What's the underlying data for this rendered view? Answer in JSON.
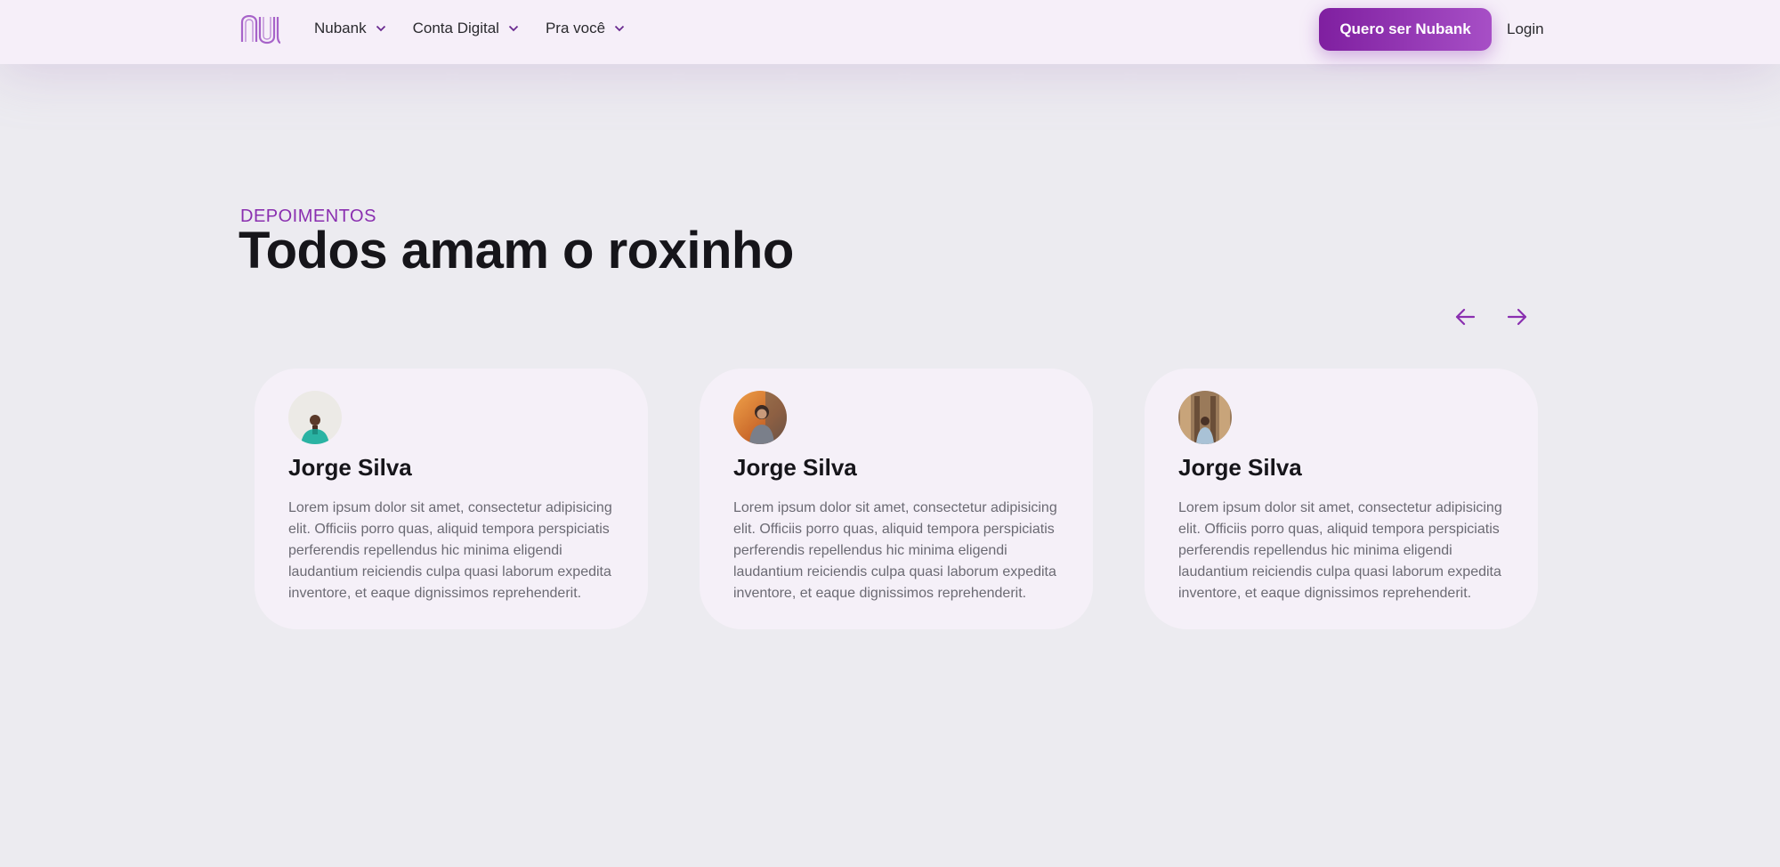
{
  "header": {
    "logo_icon": "nubank-logo-icon",
    "nav": [
      {
        "label": "Nubank"
      },
      {
        "label": "Conta Digital"
      },
      {
        "label": "Pra você"
      }
    ],
    "cta_label": "Quero ser Nubank",
    "login_label": "Login"
  },
  "section": {
    "eyebrow": "DEPOIMENTOS",
    "title": "Todos amam o roxinho",
    "prev_icon": "arrow-left-icon",
    "next_icon": "arrow-right-icon"
  },
  "testimonials": [
    {
      "name": "Jorge Silva",
      "text": "Lorem ipsum dolor sit amet, consectetur adipisicing elit. Officiis porro quas, aliquid tempora perspiciatis perferendis repellendus hic minima eligendi laudantium reiciendis culpa quasi laborum expedita inventore, et eaque dignissimos reprehenderit."
    },
    {
      "name": "Jorge Silva",
      "text": "Lorem ipsum dolor sit amet, consectetur adipisicing elit. Officiis porro quas, aliquid tempora perspiciatis perferendis repellendus hic minima eligendi laudantium reiciendis culpa quasi laborum expedita inventore, et eaque dignissimos reprehenderit."
    },
    {
      "name": "Jorge Silva",
      "text": "Lorem ipsum dolor sit amet, consectetur adipisicing elit. Officiis porro quas, aliquid tempora perspiciatis perferendis repellendus hic minima eligendi laudantium reiciendis culpa quasi laborum expedita inventore, et eaque dignissimos reprehenderit."
    }
  ],
  "colors": {
    "brand_purple": "#820ad1",
    "accent": "#8a2fb0",
    "background": "#ecebf0",
    "card": "#f5f0f8"
  }
}
